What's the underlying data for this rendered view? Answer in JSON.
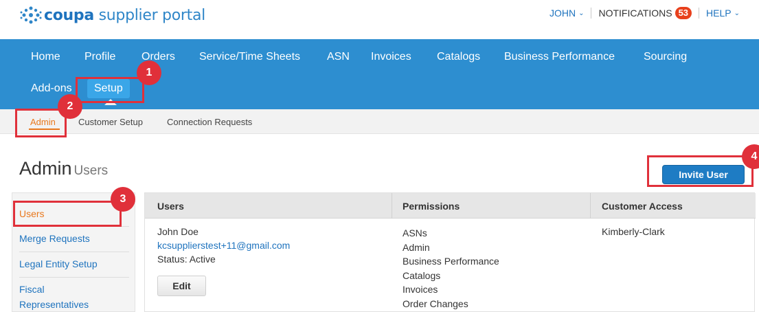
{
  "header": {
    "logo_bold": "coupa",
    "logo_light": " supplier portal",
    "user_label": "JOHN",
    "notifications_label": "NOTIFICATIONS",
    "notifications_count": "53",
    "help_label": "HELP"
  },
  "nav": {
    "items": [
      "Home",
      "Profile",
      "Orders",
      "Service/Time Sheets",
      "ASN",
      "Invoices",
      "Catalogs",
      "Business Performance",
      "Sourcing",
      "Add-ons",
      "Setup"
    ],
    "active": "Setup"
  },
  "subnav": {
    "items": [
      "Admin",
      "Customer Setup",
      "Connection Requests"
    ],
    "active": "Admin"
  },
  "page": {
    "title": "Admin",
    "subtitle": "Users",
    "invite_button": "Invite User"
  },
  "sidebar": {
    "items": [
      "Users",
      "Merge Requests",
      "Legal Entity Setup",
      "Fiscal",
      "Representatives"
    ]
  },
  "table": {
    "headers": [
      "Users",
      "Permissions",
      "Customer Access"
    ],
    "row": {
      "name": "John Doe",
      "email": "kcsupplierstest+11@gmail.com",
      "status": "Status: Active",
      "edit_button": "Edit",
      "permissions": [
        "ASNs",
        "Admin",
        "Business Performance",
        "Catalogs",
        "Invoices",
        "Order Changes"
      ],
      "customer_access": "Kimberly-Clark"
    }
  },
  "callouts": [
    "1",
    "2",
    "3",
    "4"
  ],
  "colors": {
    "nav_blue": "#2d8ed0",
    "active_tab": "#3aa6e8",
    "accent_orange": "#e8771c",
    "link_blue": "#1e73be",
    "callout_red": "#e0303a",
    "badge_red": "#e8401c"
  }
}
